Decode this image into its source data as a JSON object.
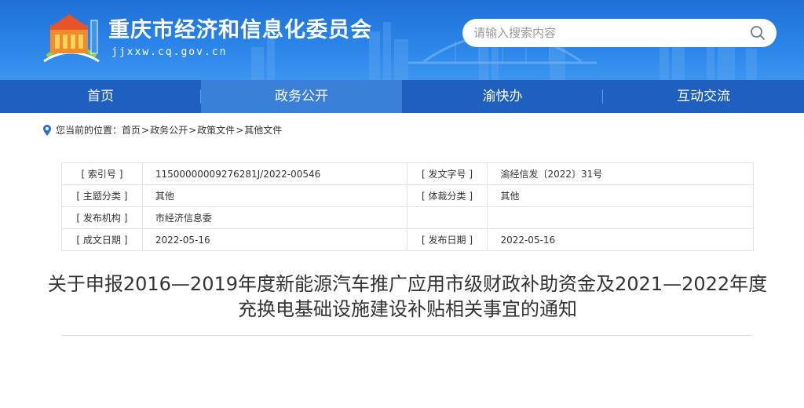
{
  "header": {
    "site_title": "重庆市经济和信息化委员会",
    "site_domain": "jjxxw.cq.gov.cn",
    "search_placeholder": "请输入搜索内容",
    "colors": {
      "banner": "#2a84e8",
      "nav": "#1e5fbf",
      "nav_active": "#3a7fd8"
    }
  },
  "nav": {
    "items": [
      {
        "label": "首页"
      },
      {
        "label": "政务公开"
      },
      {
        "label": "渝快办"
      },
      {
        "label": "互动交流"
      }
    ]
  },
  "breadcrumb": {
    "prefix": "您当前的位置：",
    "items": [
      "首页",
      "政务公开",
      "政策文件",
      "其他文件"
    ],
    "separator": ">"
  },
  "meta": {
    "index_label": "[ 索引号 ]",
    "index_value": "11500000009276281J/2022-00546",
    "doc_no_label": "[ 发文字号 ]",
    "doc_no_value": "渝经信发〔2022〕31号",
    "topic_label": "[ 主题分类 ]",
    "topic_value": "其他",
    "genre_label": "[ 体裁分类 ]",
    "genre_value": "其他",
    "org_label": "[ 发布机构 ]",
    "org_value": "市经济信息委",
    "created_label": "[ 成文日期 ]",
    "created_value": "2022-05-16",
    "published_label": "[ 发布日期 ]",
    "published_value": "2022-05-16"
  },
  "article": {
    "title_line1": "关于申报2016—2019年度新能源汽车推广应用市级财政补助资金及2021—2022年度",
    "title_line2": "充换电基础设施建设补贴相关事宜的通知"
  }
}
